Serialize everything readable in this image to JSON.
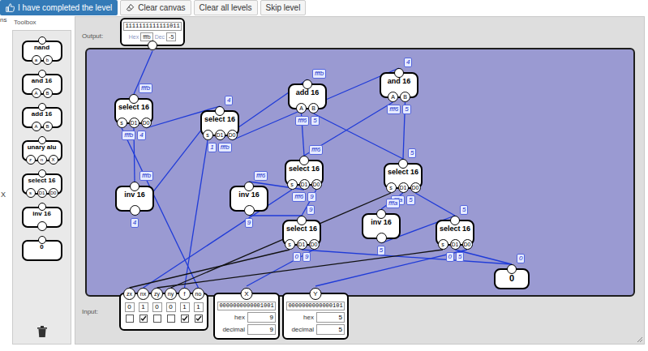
{
  "toolbar": {
    "buttons": [
      {
        "label": "I have completed the level",
        "kind": "primary"
      },
      {
        "label": "Clear canvas",
        "kind": "icon"
      },
      {
        "label": "Clear all levels",
        "kind": "plain"
      },
      {
        "label": "Skip level",
        "kind": "plain"
      }
    ]
  },
  "edge_fragments": [
    "ns",
    "X"
  ],
  "toolbox": {
    "title": "Toolbox",
    "items": [
      {
        "name": "nand",
        "pins": [
          "a",
          "b"
        ]
      },
      {
        "name": "and 16",
        "pins": [
          "A",
          "B"
        ]
      },
      {
        "name": "add 16",
        "pins": [
          "A",
          "B"
        ]
      },
      {
        "name": "unary alu",
        "pins": [
          "z",
          "n",
          "X"
        ]
      },
      {
        "name": "select 16",
        "pins": [
          "s",
          "D1",
          "D0"
        ]
      },
      {
        "name": "inv 16",
        "pins": [
          ""
        ]
      },
      {
        "name": "0",
        "pins": []
      }
    ]
  },
  "canvas": {
    "output_label": "Output:",
    "input_label": "Input:",
    "output": {
      "binary": "1111111111111011",
      "hex_label": "Hex",
      "hex": "fffb",
      "dec_label": "Dec",
      "dec": "-5"
    },
    "inputs": {
      "flags": [
        {
          "name": "zx",
          "bit": "0",
          "checked": false
        },
        {
          "name": "nx",
          "bit": "1",
          "checked": true
        },
        {
          "name": "zy",
          "bit": "0",
          "checked": false
        },
        {
          "name": "ny",
          "bit": "0",
          "checked": false
        },
        {
          "name": "f",
          "bit": "1",
          "checked": true
        },
        {
          "name": "no",
          "bit": "1",
          "checked": true
        }
      ]
    },
    "x": {
      "name": "X",
      "binary": "0000000000001001",
      "hex_label": "hex",
      "hex": "9",
      "dec_label": "decimal",
      "dec": "9"
    },
    "y": {
      "name": "Y",
      "binary": "0000000000000101",
      "hex_label": "hex",
      "hex": "5",
      "dec_label": "decimal",
      "dec": "5"
    },
    "nodes": [
      {
        "title": "select 16",
        "output": "fffb",
        "pins": [
          {
            "label": "s"
          },
          {
            "label": "D1",
            "value": "fffb"
          },
          {
            "label": "D0",
            "value": "4"
          }
        ]
      },
      {
        "title": "select 16",
        "output": "4",
        "pins": [
          {
            "label": "s",
            "value": "1"
          },
          {
            "label": "D1",
            "value": "fffb"
          },
          {
            "label": "D0"
          }
        ]
      },
      {
        "title": "add 16",
        "output": "fffb",
        "pins": [
          {
            "label": "A",
            "value": "fff6"
          },
          {
            "label": "B",
            "value": "5"
          }
        ]
      },
      {
        "title": "and 16",
        "output": "4",
        "pins": [
          {
            "label": "A",
            "value": "fff6"
          },
          {
            "label": "B",
            "value": "5"
          }
        ]
      },
      {
        "title": "select 16",
        "output": "fff6",
        "pins": [
          {
            "label": "s"
          },
          {
            "label": "D1",
            "value": "fff6"
          },
          {
            "label": "D0",
            "value": "9"
          }
        ]
      },
      {
        "title": "inv 16",
        "output": "fffb",
        "pins": [
          {
            "label": "",
            "value": "4"
          }
        ]
      },
      {
        "title": "inv 16",
        "output": "fff6",
        "pins": [
          {
            "label": "",
            "value": "9"
          }
        ]
      },
      {
        "title": "select 16",
        "output": "9",
        "pins": [
          {
            "label": "s"
          },
          {
            "label": "D1",
            "value": "0"
          },
          {
            "label": "D0",
            "value": "9"
          }
        ]
      },
      {
        "title": "select 16",
        "output": "5",
        "pins": [
          {
            "label": "s"
          },
          {
            "label": "D1",
            "value": "fffa"
          },
          {
            "label": "D0",
            "value": "5"
          }
        ]
      },
      {
        "title": "inv 16",
        "output": "fffa",
        "pins": [
          {
            "label": "",
            "value": "5"
          }
        ]
      },
      {
        "title": "select 16",
        "output": "5",
        "pins": [
          {
            "label": "s"
          },
          {
            "label": "D1",
            "value": "0"
          },
          {
            "label": "D0",
            "value": "5"
          }
        ]
      },
      {
        "title": "0",
        "output": "0",
        "pins": []
      }
    ]
  }
}
